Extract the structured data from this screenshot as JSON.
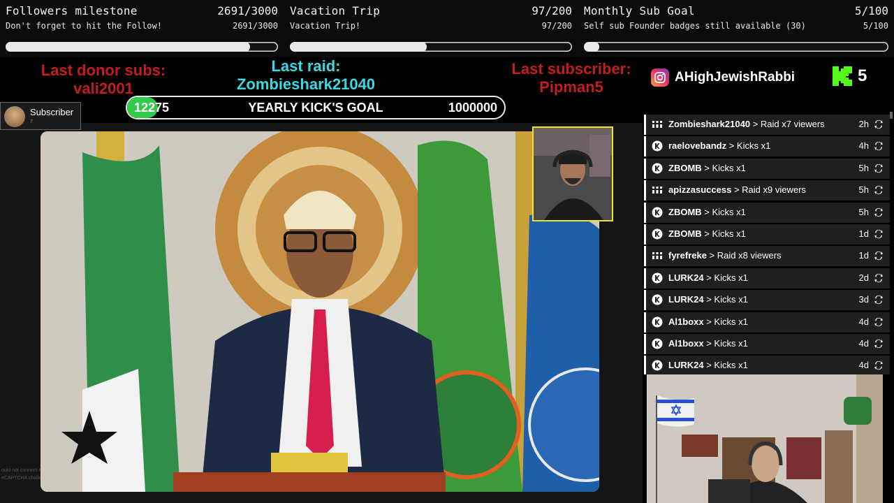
{
  "goals": [
    {
      "title": "Followers milestone",
      "count": "2691/3000",
      "subtitle": "Don't forget to hit the Follow!",
      "count2": "2691/3000",
      "progress": 0.897
    },
    {
      "title": "Vacation Trip",
      "count": "97/200",
      "subtitle": "Vacation Trip!",
      "count2": "97/200",
      "progress": 0.485
    },
    {
      "title": "Monthly Sub Goal",
      "count": "5/100",
      "subtitle": "Self sub Founder badges still available (30)",
      "count2": "5/100",
      "progress": 0.05
    }
  ],
  "last_donor": {
    "label": "Last donor subs:",
    "name": "vali2001"
  },
  "last_raid": {
    "label": "Last raid:",
    "name": "Zombieshark21040"
  },
  "last_sub": {
    "label": "Last subscriber:",
    "name": "Pipman5"
  },
  "kick_goal": {
    "current": "12275",
    "label": "YEARLY KICK'S GOAL",
    "target": "1000000",
    "progress": 0.012275
  },
  "instagram": {
    "handle": "AHighJewishRabbi"
  },
  "kick_count": "5",
  "sub_popup": {
    "label": "Subscriber",
    "small": "7"
  },
  "recaptcha_text": [
    "ould not connect to the reCAPTCHA service. Please check your internet connection and re",
    "eCAPTCHA challenge."
  ],
  "feed": [
    {
      "type": "raid",
      "user": "Zombieshark21040",
      "action": "Raid x7 viewers",
      "time": "2h"
    },
    {
      "type": "kick",
      "user": "raelovebandz",
      "action": "Kicks x1",
      "time": "4h"
    },
    {
      "type": "kick",
      "user": "ZBOMB",
      "action": "Kicks x1",
      "time": "5h"
    },
    {
      "type": "raid",
      "user": "apizzasuccess",
      "action": "Raid x9 viewers",
      "time": "5h"
    },
    {
      "type": "kick",
      "user": "ZBOMB",
      "action": "Kicks x1",
      "time": "5h"
    },
    {
      "type": "kick",
      "user": "ZBOMB",
      "action": "Kicks x1",
      "time": "1d"
    },
    {
      "type": "raid",
      "user": "fyrefreke",
      "action": "Raid x8 viewers",
      "time": "1d"
    },
    {
      "type": "kick",
      "user": "LURK24",
      "action": "Kicks x1",
      "time": "2d"
    },
    {
      "type": "kick",
      "user": "LURK24",
      "action": "Kicks x1",
      "time": "3d"
    },
    {
      "type": "kick",
      "user": "Al1boxx",
      "action": "Kicks x1",
      "time": "4d"
    },
    {
      "type": "kick",
      "user": "Al1boxx",
      "action": "Kicks x1",
      "time": "4d"
    },
    {
      "type": "kick",
      "user": "LURK24",
      "action": "Kicks x1",
      "time": "4d"
    }
  ],
  "colors": {
    "red": "#c21e1e",
    "cyan": "#3ad9e3",
    "kick_green": "#53fc18",
    "cam_border": "#f0e226"
  }
}
